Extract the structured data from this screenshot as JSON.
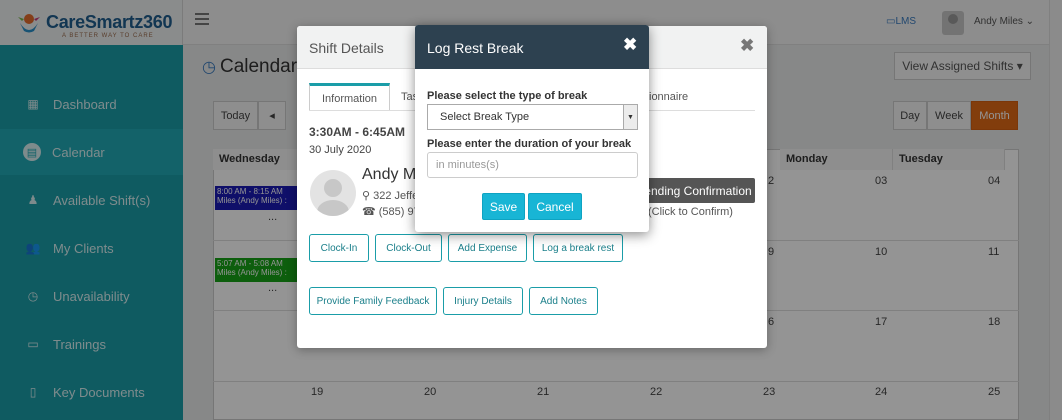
{
  "brand": {
    "name": "CareSmartz360",
    "tagline": "A BETTER WAY TO CARE"
  },
  "sidebar": {
    "items": [
      {
        "label": "Dashboard",
        "icon": "dashboard-icon",
        "active": false
      },
      {
        "label": "Calendar",
        "icon": "calendar-icon",
        "active": true
      },
      {
        "label": "Available Shift(s)",
        "icon": "person-icon",
        "active": false
      },
      {
        "label": "My Clients",
        "icon": "users-icon",
        "active": false
      },
      {
        "label": "Unavailability",
        "icon": "clock-icon",
        "active": false
      },
      {
        "label": "Trainings",
        "icon": "presentation-icon",
        "active": false
      },
      {
        "label": "Key Documents",
        "icon": "document-icon",
        "active": false
      }
    ]
  },
  "topbar": {
    "lms_label": "LMS",
    "user_name": "Andy Miles"
  },
  "calendar": {
    "title": "Calendar",
    "view_assigned_label": "View Assigned Shifts",
    "today_label": "Today",
    "prev_label": "◂",
    "views": [
      "Day",
      "Week",
      "Month"
    ],
    "active_view": "Month",
    "day_headers": [
      "Wednesday",
      "Monday",
      "Tuesday"
    ],
    "events": [
      {
        "text": "8:00 AM - 8:15 AM Miles (Andy Miles) :",
        "color": "#1b1bb5"
      },
      {
        "text": "5:07 AM - 5:08 AM Miles (Andy Miles) :",
        "color": "#17a317"
      }
    ],
    "event_more": "...",
    "day_numbers": {
      "row1": [
        "2",
        "03",
        "04"
      ],
      "row2": [
        "9",
        "10",
        "11"
      ],
      "row3": [
        "6",
        "17",
        "18"
      ],
      "row4": [
        "19",
        "20",
        "21",
        "22",
        "23",
        "24",
        "25"
      ]
    }
  },
  "shift_details": {
    "title": "Shift Details",
    "close_label": "✖",
    "tabs": [
      "Information",
      "Tas",
      "ionnaire"
    ],
    "time": "3:30AM - 6:45AM",
    "date": "30 July 2020",
    "client_name": "Andy M",
    "address": "322 Jeffe",
    "phone": "(585) 97",
    "pending_label": "ending Confirmation",
    "click_confirm_label": "(Click to Confirm)",
    "actions_row1": [
      "Clock-In",
      "Clock-Out",
      "Add Expense",
      "Log a break rest"
    ],
    "actions_row2": [
      "Provide Family Feedback",
      "Injury Details",
      "Add Notes"
    ]
  },
  "break_modal": {
    "title": "Log Rest Break",
    "close_label": "✖",
    "type_label": "Please select the type of break",
    "type_selected": "Select Break Type",
    "duration_label": "Please enter the duration of your break",
    "duration_placeholder": "in minutes(s)",
    "save_label": "Save",
    "cancel_label": "Cancel"
  },
  "colors": {
    "sidebar": "#1a9da8",
    "accent": "#18b5d5",
    "month_active": "#e06a16",
    "modal_header": "#2d4150"
  }
}
